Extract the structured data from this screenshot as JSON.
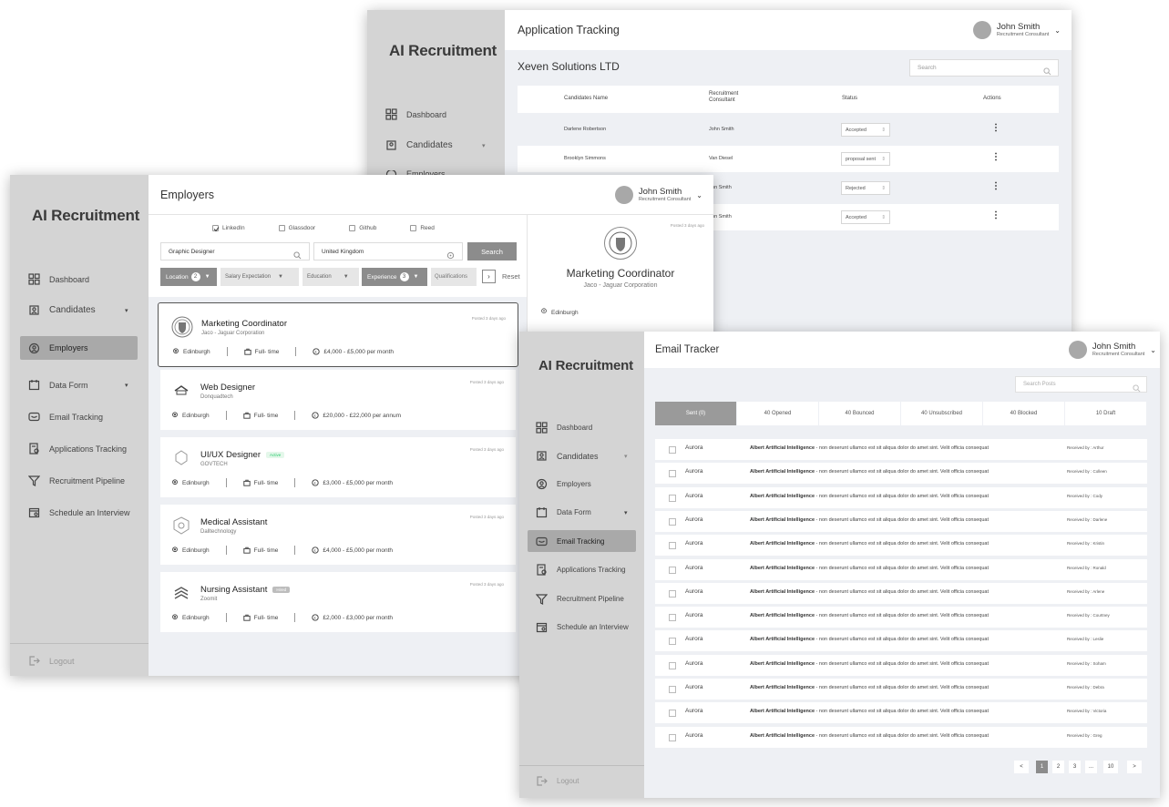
{
  "w1": {
    "brand": "AI Recruitment",
    "nav": [
      {
        "label": "Dashboard",
        "icon": "dashboard-icon"
      },
      {
        "label": "Candidates",
        "icon": "candidates-icon"
      },
      {
        "label": "Employers",
        "icon": "employers-icon"
      }
    ],
    "title": "Application Tracking",
    "user": {
      "name": "John Smith",
      "role": "Recruitment Consultant"
    },
    "company": "Xeven Solutions LTD",
    "search_placeholder": "Search",
    "headers": [
      "Candidates Name",
      "Recruitment Consultant",
      "Status",
      "Actions"
    ],
    "rows": [
      {
        "name": "Darlene Robertson",
        "consultant": "John Smith",
        "status": "Accepted"
      },
      {
        "name": "Brooklyn Simmons",
        "consultant": "Van Diesel",
        "status": "proposal sent"
      },
      {
        "name": "",
        "consultant": "ohn Smith",
        "status": "Rejected"
      },
      {
        "name": "",
        "consultant": "ohn Smith",
        "status": "Accepted"
      }
    ]
  },
  "w2": {
    "brand": "AI Recruitment",
    "nav": [
      {
        "label": "Dashboard"
      },
      {
        "label": "Candidates"
      },
      {
        "label": "Employers"
      },
      {
        "label": "Data Form"
      },
      {
        "label": "Email Tracking"
      },
      {
        "label": "Applications Tracking"
      },
      {
        "label": "Recruitment Pipeline"
      },
      {
        "label": "Schedule an Interview"
      }
    ],
    "logout": "Logout",
    "title": "Employers",
    "user": {
      "name": "John Smith",
      "role": "Recruitment Consultant"
    },
    "sources": [
      {
        "label": "LinkedIn",
        "checked": true
      },
      {
        "label": "Glassdoor",
        "checked": false
      },
      {
        "label": "Github",
        "checked": false
      },
      {
        "label": "Reed",
        "checked": false
      }
    ],
    "keyword_value": "Graphic Designer",
    "location_value": "United Kingdom",
    "search_button": "Search",
    "filters": {
      "location": "Location",
      "location_count": "2",
      "salary": "Salary Expectation",
      "education": "Education",
      "experience": "Experience",
      "experience_count": "3",
      "qualifications": "Qualifications",
      "reset": "Reset"
    },
    "jobs": [
      {
        "title": "Marketing Coordinator",
        "company": "Jaco - Jaguar Corporation",
        "posted": "Posted 3 days ago",
        "location": "Edinburgh",
        "type": "Full- time",
        "salary": "£4,000 - £5,000 per month",
        "badge": ""
      },
      {
        "title": "Web Designer",
        "company": "Donquadtech",
        "posted": "Posted 3 days ago",
        "location": "Edinburgh",
        "type": "Full- time",
        "salary": "£20,000 - £22,000 per annum",
        "badge": ""
      },
      {
        "title": "UI/UX Designer",
        "company": "GOVTECH",
        "posted": "Posted 3 days ago",
        "location": "Edinburgh",
        "type": "Full- time",
        "salary": "£3,000 - £5,000 per month",
        "badge": "Active"
      },
      {
        "title": "Medical Assistant",
        "company": "Dalltechnology",
        "posted": "Posted 3 days ago",
        "location": "Edinburgh",
        "type": "Full- time",
        "salary": "£4,000 - £5,000 per month",
        "badge": ""
      },
      {
        "title": "Nursing Assistant",
        "company": "Zoomit",
        "posted": "Posted 3 days ago",
        "location": "Edinburgh",
        "type": "Full- time",
        "salary": "£2,000 - £3,000 per month",
        "badge": "Hired"
      }
    ],
    "detail": {
      "posted": "Posted 3 days ago",
      "title": "Marketing Coordinator",
      "company": "Jaco - Jaguar Corporation",
      "location": "Edinburgh"
    }
  },
  "w3": {
    "brand": "AI Recruitment",
    "nav": [
      {
        "label": "Dashboard"
      },
      {
        "label": "Candidates"
      },
      {
        "label": "Employers"
      },
      {
        "label": "Data Form"
      },
      {
        "label": "Email Tracking"
      },
      {
        "label": "Applications Tracking"
      },
      {
        "label": "Recruitment Pipeline"
      },
      {
        "label": "Schedule an Interview"
      }
    ],
    "logout": "Logout",
    "title": "Email Tracker",
    "user": {
      "name": "John Smith",
      "role": "Recruitment Consultant"
    },
    "search_placeholder": "Search Posts",
    "tabs": [
      "Sent (0)",
      "40 Opened",
      "40 Bounced",
      "40 Unsubscribed",
      "40 Blocked",
      "10 Draft"
    ],
    "email_sender": "Aurora",
    "email_subject": "Albert Artificial Intelligence",
    "email_snippet": " - non deserunt ullamco est sit aliqua dolor do amet sint. Velit officia consequat",
    "recipients": [
      "Received by : Arthur",
      "Received by : Colleen",
      "Received by : Cody",
      "Received by : Darlene",
      "Received by : Kristin",
      "Received by : Ronald",
      "Received by : Arlene",
      "Received by : Courtney",
      "Received by : Leslie",
      "Received by : Soham",
      "Received by : Debra",
      "Received by : Victoria",
      "Received by : Greg"
    ],
    "pages": [
      "<",
      "1",
      "2",
      "3",
      "...",
      "10",
      ">"
    ]
  },
  "colors": {
    "sidebar": "#d4d4d4",
    "active_nav": "#a9a9a9",
    "panel": "#eef0f4",
    "button": "#8c8c8c",
    "active_badge": "#2ecc71"
  }
}
